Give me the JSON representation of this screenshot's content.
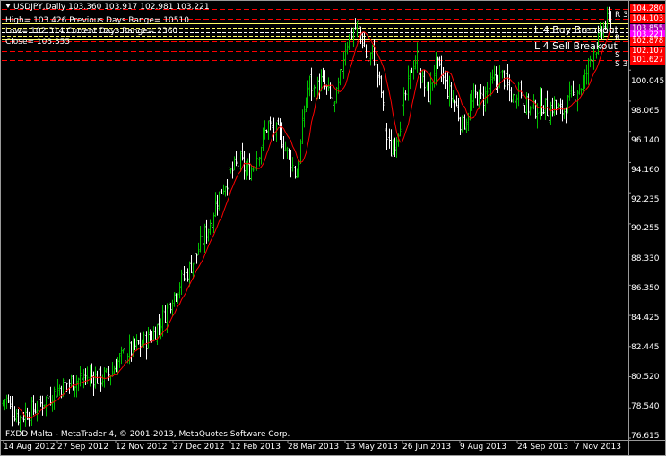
{
  "header": {
    "symbol_line": "USDJPY,Daily  103.360 103.917 102.981 103.221",
    "high_line": "High= 103.426     Previous Days Range= 10510",
    "low_line": "Low= 102.314     Current Days Range= 2360",
    "close_line": "Close= 103.355"
  },
  "levels": {
    "buy_label": "L 4 Buy Breakout",
    "sell_label": "L 4 Sell Breakout",
    "r3": "R 3",
    "r": "R",
    "s": "S",
    "s3": "S 3"
  },
  "price_tags": [
    {
      "text": "104.280",
      "color": "#ff0000"
    },
    {
      "text": "104.103",
      "color": "#ff0000"
    },
    {
      "text": "103.855",
      "color": "#b000b0"
    },
    {
      "text": "103.221",
      "color": "#ff00ff"
    },
    {
      "text": "102.878",
      "color": "#ff0000"
    },
    {
      "text": "102.107",
      "color": "#ff0000"
    },
    {
      "text": "101.627",
      "color": "#ff0000"
    }
  ],
  "price_axis": [
    "100.045",
    "98.065",
    "96.140",
    "94.160",
    "92.235",
    "90.255",
    "88.330",
    "86.350",
    "84.425",
    "82.445",
    "80.520",
    "78.540",
    "76.615"
  ],
  "date_axis": [
    "14 Aug 2012",
    "27 Sep 2012",
    "12 Nov 2012",
    "27 Dec 2012",
    "12 Feb 2013",
    "28 Mar 2013",
    "13 May 2013",
    "26 Jun 2013",
    "9 Aug 2013",
    "24 Sep 2013",
    "7 Nov 2013"
  ],
  "footer": {
    "copyright": "FXDD Malta - MetaTrader 4, © 2001-2013, MetaQuotes Software Corp."
  },
  "colors": {
    "bull": "#00c000",
    "bear": "#ffffff",
    "ma": "#ff0000",
    "level_red": "#ff0000",
    "level_yellow": "#ffff66"
  },
  "chart_data": {
    "type": "candlestick",
    "symbol": "USDJPY",
    "timeframe": "Daily",
    "ylim": [
      76.615,
      104.28
    ],
    "moving_average": true,
    "x_range": [
      "14 Aug 2012",
      "7 Nov 2013"
    ],
    "close_path": [
      [
        0,
        78.8
      ],
      [
        6,
        79.2
      ],
      [
        12,
        78.5
      ],
      [
        18,
        78.1
      ],
      [
        22,
        77.9
      ],
      [
        28,
        78.2
      ],
      [
        35,
        78.4
      ],
      [
        45,
        78.8
      ],
      [
        55,
        79.3
      ],
      [
        65,
        79.8
      ],
      [
        75,
        80.1
      ],
      [
        85,
        80.3
      ],
      [
        100,
        80.6
      ],
      [
        110,
        80.4
      ],
      [
        118,
        80.5
      ],
      [
        125,
        80.9
      ],
      [
        130,
        81.4
      ],
      [
        140,
        82.0
      ],
      [
        150,
        82.4
      ],
      [
        160,
        82.7
      ],
      [
        170,
        83.2
      ],
      [
        180,
        84.1
      ],
      [
        190,
        85.4
      ],
      [
        200,
        86.4
      ],
      [
        210,
        87.3
      ],
      [
        220,
        88.4
      ],
      [
        228,
        89.6
      ],
      [
        235,
        90.4
      ],
      [
        240,
        91.5
      ],
      [
        248,
        92.6
      ],
      [
        255,
        93.3
      ],
      [
        262,
        93.9
      ],
      [
        268,
        94.2
      ],
      [
        275,
        93.5
      ],
      [
        282,
        93.9
      ],
      [
        290,
        95.2
      ],
      [
        298,
        96.6
      ],
      [
        305,
        96.2
      ],
      [
        312,
        95.9
      ],
      [
        320,
        94.8
      ],
      [
        325,
        94.2
      ],
      [
        330,
        93.2
      ],
      [
        335,
        95.4
      ],
      [
        340,
        98.0
      ],
      [
        345,
        99.3
      ],
      [
        350,
        98.7
      ],
      [
        358,
        99.3
      ],
      [
        365,
        98.7
      ],
      [
        372,
        97.6
      ],
      [
        378,
        99.2
      ],
      [
        385,
        101.6
      ],
      [
        392,
        102.5
      ],
      [
        398,
        102.9
      ],
      [
        404,
        102.0
      ],
      [
        410,
        100.6
      ],
      [
        415,
        101.3
      ],
      [
        420,
        99.9
      ],
      [
        425,
        98.7
      ],
      [
        430,
        96.0
      ],
      [
        435,
        94.8
      ],
      [
        440,
        95.6
      ],
      [
        445,
        96.6
      ],
      [
        450,
        97.8
      ],
      [
        455,
        99.2
      ],
      [
        460,
        100.5
      ],
      [
        465,
        100.8
      ],
      [
        470,
        99.5
      ],
      [
        478,
        98.4
      ],
      [
        485,
        100.4
      ],
      [
        492,
        99.8
      ],
      [
        500,
        98.6
      ],
      [
        508,
        97.9
      ],
      [
        515,
        96.5
      ],
      [
        520,
        97.0
      ],
      [
        525,
        97.8
      ],
      [
        530,
        98.4
      ],
      [
        538,
        98.2
      ],
      [
        545,
        98.9
      ],
      [
        552,
        99.4
      ],
      [
        560,
        99.7
      ],
      [
        566,
        98.9
      ],
      [
        572,
        98.2
      ],
      [
        578,
        99.1
      ],
      [
        585,
        97.9
      ],
      [
        592,
        97.5
      ],
      [
        598,
        97.6
      ],
      [
        605,
        97.9
      ],
      [
        612,
        97.4
      ],
      [
        618,
        97.9
      ],
      [
        625,
        97.3
      ],
      [
        632,
        97.9
      ],
      [
        638,
        98.3
      ],
      [
        644,
        98.9
      ],
      [
        650,
        99.1
      ],
      [
        655,
        100.1
      ],
      [
        660,
        101.1
      ],
      [
        665,
        101.6
      ],
      [
        670,
        102.4
      ],
      [
        676,
        103.1
      ],
      [
        683,
        103.2
      ]
    ]
  }
}
